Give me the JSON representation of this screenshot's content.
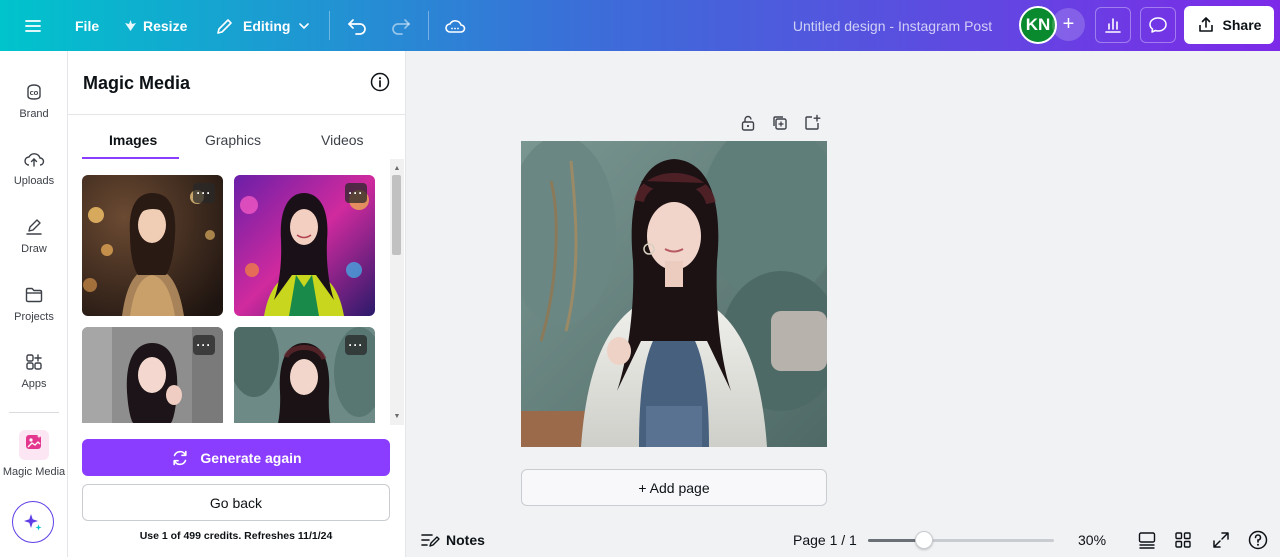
{
  "topbar": {
    "file_label": "File",
    "resize_label": "Resize",
    "editing_label": "Editing",
    "design_title": "Untitled design - Instagram Post",
    "avatar_initials": "KN",
    "share_label": "Share"
  },
  "rail": {
    "items": [
      {
        "label": "Brand",
        "icon": "brand-icon"
      },
      {
        "label": "Uploads",
        "icon": "cloud-upload-icon"
      },
      {
        "label": "Draw",
        "icon": "pen-icon"
      },
      {
        "label": "Projects",
        "icon": "folder-icon"
      },
      {
        "label": "Apps",
        "icon": "apps-icon"
      },
      {
        "label": "Magic Media",
        "icon": "magic-media-icon"
      }
    ]
  },
  "panel": {
    "title": "Magic Media",
    "tabs": [
      "Images",
      "Graphics",
      "Videos"
    ],
    "active_tab": "Images",
    "generate_label": "Generate again",
    "back_label": "Go back",
    "credits_text": "Use 1 of 499 credits. Refreshes 11/1/24"
  },
  "canvas": {
    "add_page_label": "+ Add page"
  },
  "bottombar": {
    "notes_label": "Notes",
    "page_label": "Page 1 / 1",
    "zoom_label": "30%",
    "zoom_fraction": 0.3
  },
  "colors": {
    "accent": "#8b3dff",
    "gradient_start": "#00c4cc",
    "gradient_end": "#7d2ae8"
  }
}
